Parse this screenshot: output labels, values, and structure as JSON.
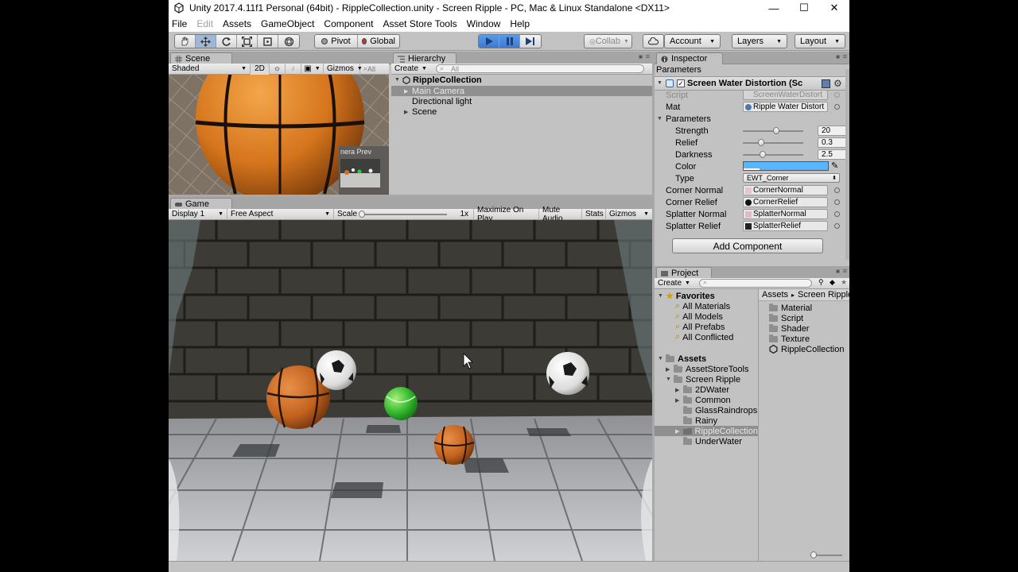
{
  "window": {
    "title": "Unity 2017.4.11f1 Personal (64bit) - RippleCollection.unity - Screen Ripple - PC, Mac & Linux Standalone <DX11>",
    "min_glyph": "—",
    "max_glyph": "☐",
    "close_glyph": "✕"
  },
  "menu": {
    "items": [
      "File",
      "Edit",
      "Assets",
      "GameObject",
      "Component",
      "Asset Store Tools",
      "Window",
      "Help"
    ]
  },
  "toolbar": {
    "pivot": "Pivot",
    "global": "Global",
    "collab": "Collab",
    "account": "Account",
    "layers": "Layers",
    "layout": "Layout"
  },
  "scene": {
    "tab": "Scene",
    "shading": "Shaded",
    "mode_2d": "2D",
    "gizmos": "Gizmos",
    "search_prefix": "All",
    "camera_preview_label": "nera Prev"
  },
  "hierarchy": {
    "tab": "Hierarchy",
    "create": "Create",
    "search_placeholder": "All",
    "scene_name": "RippleCollection",
    "items": [
      {
        "label": "Main Camera",
        "selected": true
      },
      {
        "label": "Directional light",
        "selected": false
      },
      {
        "label": "Scene",
        "selected": false
      }
    ]
  },
  "game": {
    "tab": "Game",
    "display": "Display 1",
    "aspect": "Free Aspect",
    "scale_label": "Scale",
    "scale_value": "1x",
    "maximize": "Maximize On Play",
    "mute": "Mute Audio",
    "stats": "Stats",
    "gizmos": "Gizmos"
  },
  "inspector": {
    "tab": "Inspector",
    "header": "Parameters",
    "component_title": "Screen Water Distortion (Sc",
    "script_label": "Script",
    "script_value": "ScreenWaterDistort",
    "mat_label": "Mat",
    "mat_value": "Ripple Water Distort",
    "params_label": "Parameters",
    "strength_label": "Strength",
    "strength_value": "20",
    "strength_fraction": 0.55,
    "relief_label": "Relief",
    "relief_value": "0.3",
    "relief_fraction": 0.3,
    "darkness_label": "Darkness",
    "darkness_value": "2.5",
    "darkness_fraction": 0.33,
    "color_label": "Color",
    "color_hex": "#56b6ff",
    "type_label": "Type",
    "type_value": "EWT_Corner",
    "corner_normal_label": "Corner Normal",
    "corner_normal_value": "CornerNormal",
    "corner_relief_label": "Corner Relief",
    "corner_relief_value": "CornerRelief",
    "splatter_normal_label": "Splatter Normal",
    "splatter_normal_value": "SplatterNormal",
    "splatter_relief_label": "Splatter Relief",
    "splatter_relief_value": "SplatterRelief",
    "add_component": "Add Component"
  },
  "project": {
    "tab": "Project",
    "create": "Create",
    "favorites_label": "Favorites",
    "favorites": [
      "All Materials",
      "All Models",
      "All Prefabs",
      "All Conflicted"
    ],
    "assets_label": "Assets",
    "tree": [
      {
        "label": "AssetStoreTools",
        "depth": 1,
        "expand": "▶",
        "selected": false
      },
      {
        "label": "Screen Ripple",
        "depth": 1,
        "expand": "▼",
        "selected": false
      },
      {
        "label": "2DWater",
        "depth": 2,
        "expand": "▶",
        "selected": false
      },
      {
        "label": "Common",
        "depth": 2,
        "expand": "▶",
        "selected": false
      },
      {
        "label": "GlassRaindrops",
        "depth": 2,
        "expand": "",
        "selected": false
      },
      {
        "label": "Rainy",
        "depth": 2,
        "expand": "",
        "selected": false
      },
      {
        "label": "RippleCollection",
        "depth": 2,
        "expand": "▶",
        "selected": true
      },
      {
        "label": "UnderWater",
        "depth": 2,
        "expand": "",
        "selected": false
      }
    ],
    "breadcrumb_root": "Assets",
    "breadcrumb_sep": "▸",
    "breadcrumb_current": "Screen Ripple",
    "contents": [
      {
        "label": "Material",
        "kind": "folder"
      },
      {
        "label": "Script",
        "kind": "folder"
      },
      {
        "label": "Shader",
        "kind": "folder"
      },
      {
        "label": "Texture",
        "kind": "folder"
      },
      {
        "label": "RippleCollection",
        "kind": "scene"
      }
    ]
  }
}
